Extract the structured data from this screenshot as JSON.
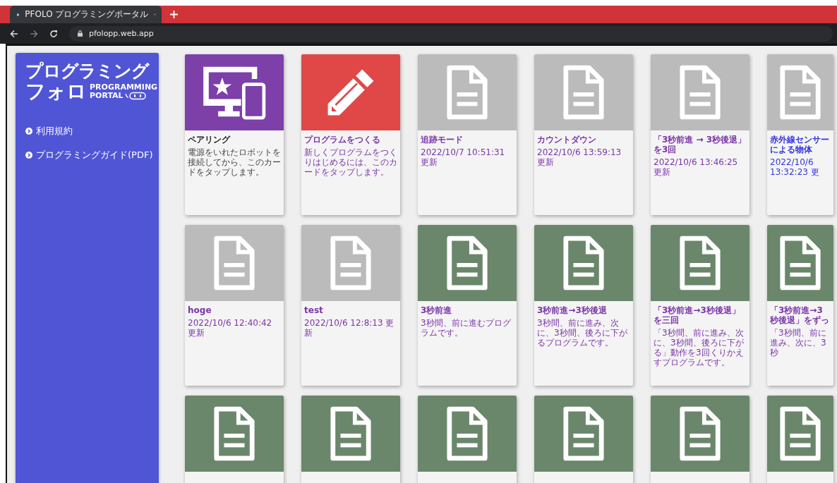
{
  "browser": {
    "tab_title": "PFOLO プログラミングポータル",
    "url": "pfolopp.web.app"
  },
  "sidebar": {
    "logo": {
      "main_top": "プログラミング",
      "main_bottom": "フォロ",
      "sub_top": "PROGRAMMING",
      "sub_bottom": "PORTAL"
    },
    "links": [
      {
        "label": "利用規約"
      },
      {
        "label": "プログラミングガイド(PDF)"
      }
    ]
  },
  "cards": [
    {
      "kind": "pairing",
      "title": "ペアリング",
      "text": "電源をいれたロボットを接続してから、このカードをタップします。",
      "color": "#222222"
    },
    {
      "kind": "create",
      "title": "プログラムをつくる",
      "text": "新しくプログラムをつくりはじめるには、このカードをタップします。",
      "color": "#7b35a8"
    },
    {
      "kind": "user",
      "title": "追跡モード",
      "text": "2022/10/7 10:51:31 更新",
      "color": "#7b35a8"
    },
    {
      "kind": "user",
      "title": "カウントダウン",
      "text": "2022/10/6 13:59:13 更新",
      "color": "#7b35a8"
    },
    {
      "kind": "user",
      "title": "「3秒前進 → 3秒後退」を3回",
      "text": "2022/10/6 13:46:25 更新",
      "color": "#7b35a8"
    },
    {
      "kind": "user",
      "title": "赤外線センサーによる物体",
      "text": "2022/10/6 13:32:23 更",
      "color": "#3333dd"
    },
    {
      "kind": "user",
      "title": "hoge",
      "text": "2022/10/6 12:40:42 更新",
      "color": "#7b35a8"
    },
    {
      "kind": "user",
      "title": "test",
      "text": "2022/10/6 12:8:13 更新",
      "color": "#7b35a8"
    },
    {
      "kind": "sample",
      "title": "3秒前進",
      "text": "3秒間、前に進むプログラムです。",
      "color": "#7b35a8"
    },
    {
      "kind": "sample",
      "title": "3秒前進→3秒後退",
      "text": "3秒間、前に進み、次に、3秒間、後ろに下がるプログラムです。",
      "color": "#7b35a8"
    },
    {
      "kind": "sample",
      "title": "「3秒前進→3秒後退」を三回",
      "text": "「3秒間、前に進み、次に、3秒間、後ろに下がる」動作を3回くりかえすプログラムです。",
      "color": "#7b35a8"
    },
    {
      "kind": "sample",
      "title": "「3秒前進→3秒後退」をずっ",
      "text": "「3秒間、前に進み、次に、3秒",
      "color": "#7b35a8"
    },
    {
      "kind": "sample"
    },
    {
      "kind": "sample"
    },
    {
      "kind": "sample"
    },
    {
      "kind": "sample"
    },
    {
      "kind": "sample"
    },
    {
      "kind": "sample"
    }
  ]
}
